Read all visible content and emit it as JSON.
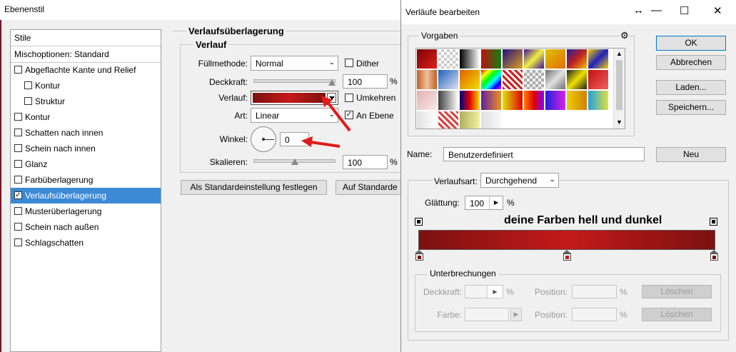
{
  "ebenenstil": {
    "title": "Ebenenstil",
    "styles_list": {
      "header": "Stile",
      "blend_options": "Mischoptionen: Standard",
      "items": [
        {
          "label": "Abgeflachte Kante und Relief",
          "checked": false,
          "indent": false
        },
        {
          "label": "Kontur",
          "checked": false,
          "indent": true
        },
        {
          "label": "Struktur",
          "checked": false,
          "indent": true
        },
        {
          "label": "Kontur",
          "checked": false,
          "indent": false
        },
        {
          "label": "Schatten nach innen",
          "checked": false,
          "indent": false
        },
        {
          "label": "Schein nach innen",
          "checked": false,
          "indent": false
        },
        {
          "label": "Glanz",
          "checked": false,
          "indent": false
        },
        {
          "label": "Farbüberlagerung",
          "checked": false,
          "indent": false
        },
        {
          "label": "Verlaufsüberlagerung",
          "checked": true,
          "indent": false,
          "selected": true
        },
        {
          "label": "Musterüberlagerung",
          "checked": false,
          "indent": false
        },
        {
          "label": "Schein nach außen",
          "checked": false,
          "indent": false
        },
        {
          "label": "Schlagschatten",
          "checked": false,
          "indent": false
        }
      ]
    },
    "section_title": "Verlaufsüberlagerung",
    "subsection_title": "Verlauf",
    "fuellmethode": {
      "label": "Füllmethode:",
      "value": "Normal"
    },
    "dither": {
      "label": "Dither",
      "checked": false
    },
    "deckkraft": {
      "label": "Deckkraft:",
      "value": "100",
      "unit": "%",
      "level": 1.0
    },
    "verlauf": {
      "label": "Verlauf:"
    },
    "umkehren": {
      "label": "Umkehren",
      "checked": false
    },
    "art": {
      "label": "Art:",
      "value": "Linear"
    },
    "an_ebene": {
      "label": "An Ebene",
      "checked": true
    },
    "winkel": {
      "label": "Winkel:",
      "value": "0"
    },
    "skalieren": {
      "label": "Skalieren:",
      "value": "100",
      "unit": "%",
      "level": 0.5
    },
    "btn_default_set": "Als Standardeinstellung festlegen",
    "btn_default_reset": "Auf Standarde"
  },
  "verlaeufe": {
    "title": "Verläufe bearbeiten",
    "controls": {
      "move": "↔",
      "minimize": "—",
      "maximize": "☐",
      "close": "✕"
    },
    "vorgaben_label": "Vorgaben",
    "gear": "⚙",
    "buttons": {
      "ok": "OK",
      "abbrechen": "Abbrechen",
      "laden": "Laden...",
      "speichern": "Speichern...",
      "neu": "Neu"
    },
    "name": {
      "label": "Name:",
      "value": "Benutzerdefiniert"
    },
    "verlaufsart": {
      "label": "Verlaufsart:",
      "value": "Durchgehend"
    },
    "glaettung": {
      "label": "Glättung:",
      "value": "100",
      "unit": "%"
    },
    "annotation": "deine Farben hell und dunkel",
    "unterbrechungen": {
      "title": "Unterbrechungen",
      "deckkraft_label": "Deckkraft:",
      "farbe_label": "Farbe:",
      "position_label": "Position:",
      "unit": "%",
      "loeschen": "Löschen"
    },
    "colors": {
      "dark_red": "#7d1010",
      "bright_red": "#c41a1a"
    }
  }
}
